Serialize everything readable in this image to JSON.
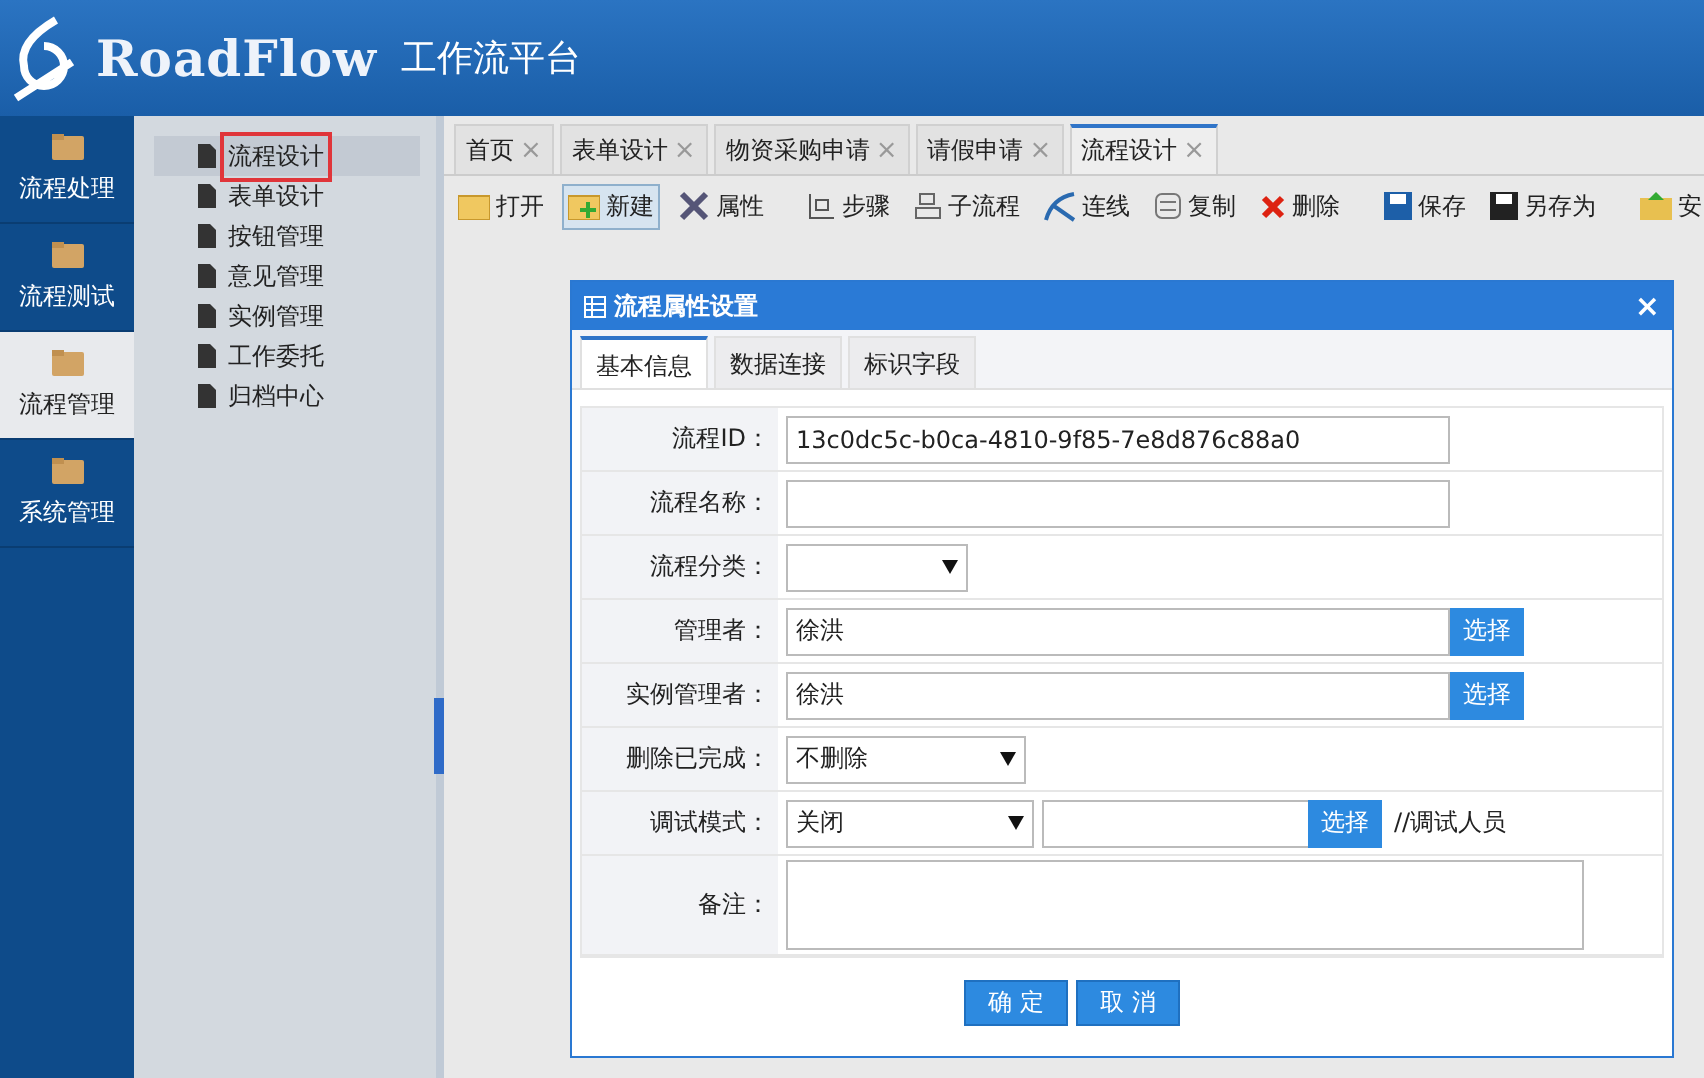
{
  "header": {
    "logo": "RoadFlow",
    "subtitle": "工作流平台"
  },
  "nav": [
    {
      "label": "流程处理",
      "selected": false
    },
    {
      "label": "流程测试",
      "selected": false
    },
    {
      "label": "流程管理",
      "selected": true
    },
    {
      "label": "系统管理",
      "selected": false
    }
  ],
  "tree": [
    {
      "label": "流程设计",
      "selected": true,
      "marked": true
    },
    {
      "label": "表单设计",
      "selected": false,
      "marked": false
    },
    {
      "label": "按钮管理",
      "selected": false,
      "marked": false
    },
    {
      "label": "意见管理",
      "selected": false,
      "marked": false
    },
    {
      "label": "实例管理",
      "selected": false,
      "marked": false
    },
    {
      "label": "工作委托",
      "selected": false,
      "marked": false
    },
    {
      "label": "归档中心",
      "selected": false,
      "marked": false
    }
  ],
  "tabs": [
    {
      "label": "首页",
      "selected": false,
      "close": "×"
    },
    {
      "label": "表单设计",
      "selected": false,
      "close": "×"
    },
    {
      "label": "物资采购申请",
      "selected": false,
      "close": "×"
    },
    {
      "label": "请假申请",
      "selected": false,
      "close": "×"
    },
    {
      "label": "流程设计",
      "selected": true,
      "close": "×"
    }
  ],
  "toolbar": [
    {
      "kind": "open",
      "label": "打开",
      "pressed": false
    },
    {
      "kind": "new",
      "label": "新建",
      "pressed": true
    },
    {
      "kind": "tools",
      "label": "属性",
      "pressed": false
    },
    {
      "kind": "sep"
    },
    {
      "kind": "step",
      "label": "步骤",
      "pressed": false
    },
    {
      "kind": "subflow",
      "label": "子流程",
      "pressed": false
    },
    {
      "kind": "line",
      "label": "连线",
      "pressed": false
    },
    {
      "kind": "copy",
      "label": "复制",
      "pressed": false
    },
    {
      "kind": "delete",
      "label": "删除",
      "pressed": false
    },
    {
      "kind": "sep"
    },
    {
      "kind": "save",
      "label": "保存",
      "pressed": false
    },
    {
      "kind": "saveas",
      "label": "另存为",
      "pressed": false
    },
    {
      "kind": "sep"
    },
    {
      "kind": "install",
      "label": "安",
      "pressed": false
    }
  ],
  "dialog": {
    "title": "流程属性设置",
    "close": "×",
    "tabs": [
      {
        "label": "基本信息",
        "selected": true
      },
      {
        "label": "数据连接",
        "selected": false
      },
      {
        "label": "标识字段",
        "selected": false
      }
    ],
    "fields": [
      {
        "kind": "text",
        "label": "流程ID：",
        "value": "13c0dc5c-b0ca-4810-9f85-7e8d876c88a0"
      },
      {
        "kind": "text",
        "label": "流程名称："
      },
      {
        "kind": "select",
        "label": "流程分类："
      },
      {
        "kind": "picker",
        "label": "管理者：",
        "value": "徐洪",
        "button": "选择"
      },
      {
        "kind": "picker",
        "label": "实例管理者：",
        "value": "徐洪",
        "button": "选择"
      },
      {
        "kind": "select",
        "label": "删除已完成：",
        "value": "不删除"
      },
      {
        "kind": "select-picker",
        "label": "调试模式：",
        "value": "关闭",
        "button": "选择",
        "note": "//调试人员"
      },
      {
        "kind": "textarea",
        "label": "备注："
      }
    ],
    "buttons": [
      "确 定",
      "取 消"
    ]
  }
}
